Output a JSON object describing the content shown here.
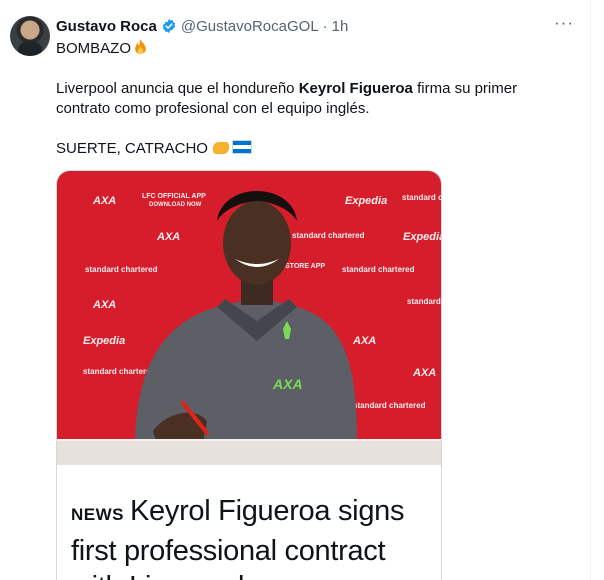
{
  "tweet": {
    "author_name": "Gustavo Roca",
    "author_handle": "@GustavoRocaGOL",
    "time": "1h",
    "separator": "·",
    "more": "···",
    "line1": "BOMBAZO",
    "line2_before": "Liverpool anuncia que el hondureño ",
    "line2_bold": "Keyrol Figueroa",
    "line2_after": " firma su primer contrato como profesional con el equipo inglés.",
    "line3": "SUERTE, CATRACHO"
  },
  "media": {
    "sponsors": [
      "AXA",
      "LFC OFFICIAL APP",
      "DOWNLOAD NOW",
      "standard chartered",
      "Expedia",
      "STORE APP"
    ],
    "shirt_logo": "AXA",
    "news_tag": "NEWS",
    "headline": "Keyrol Figueroa signs first professional contract with Liverpool"
  },
  "icons": {
    "verified": "verified-badge-icon",
    "fire": "fire-emoji",
    "handshake": "handshake-emoji",
    "flag": "honduras-flag-emoji"
  },
  "colors": {
    "verified_blue": "#1d9bf0",
    "backdrop_red": "#d61d2b",
    "muted_text": "#536471"
  }
}
